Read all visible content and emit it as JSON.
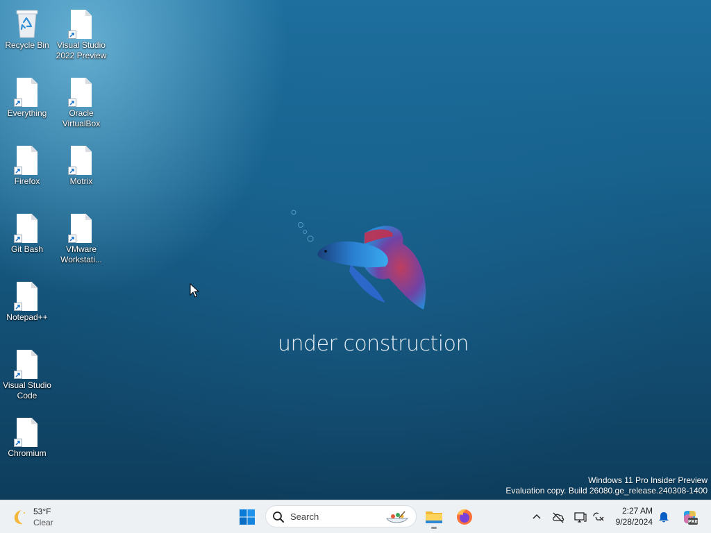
{
  "desktop": {
    "icons": [
      {
        "label": "Recycle Bin",
        "icon": "recycle-bin-icon"
      },
      {
        "label": "Visual Studio 2022 Preview",
        "icon": "file-shortcut-icon"
      },
      {
        "label": "Everything",
        "icon": "file-shortcut-icon"
      },
      {
        "label": "Oracle VirtualBox",
        "icon": "file-shortcut-icon"
      },
      {
        "label": "Firefox",
        "icon": "file-shortcut-icon"
      },
      {
        "label": "Motrix",
        "icon": "file-shortcut-icon"
      },
      {
        "label": "Git Bash",
        "icon": "file-shortcut-icon"
      },
      {
        "label": "VMware Workstati...",
        "icon": "file-shortcut-icon"
      },
      {
        "label": "Notepad++",
        "icon": "file-shortcut-icon"
      },
      {
        "label": "Visual Studio Code",
        "icon": "file-shortcut-icon"
      },
      {
        "label": "Chromium",
        "icon": "file-shortcut-icon"
      }
    ],
    "wallpaper_text": "under construction",
    "watermark": {
      "line1": "Windows 11 Pro Insider Preview",
      "line2": "Evaluation copy. Build 26080.ge_release.240308-1400"
    }
  },
  "taskbar": {
    "weather": {
      "temp": "53°F",
      "condition": "Clear",
      "icon": "moon-icon"
    },
    "search_placeholder": "Search",
    "apps": [
      {
        "name": "File Explorer",
        "icon": "folder-icon",
        "running": true
      },
      {
        "name": "Firefox",
        "icon": "firefox-icon",
        "running": false
      }
    ],
    "tray": {
      "icons": [
        "chevron-up-icon",
        "cloud-off-icon",
        "display-icon",
        "network-icon",
        "bell-icon",
        "copilot-icon"
      ]
    },
    "clock": {
      "time": "2:27 AM",
      "date": "9/28/2024"
    }
  },
  "colors": {
    "taskbar_bg": "#eef1f4",
    "accent": "#0078d4",
    "desktop_bg": "#17618c"
  }
}
